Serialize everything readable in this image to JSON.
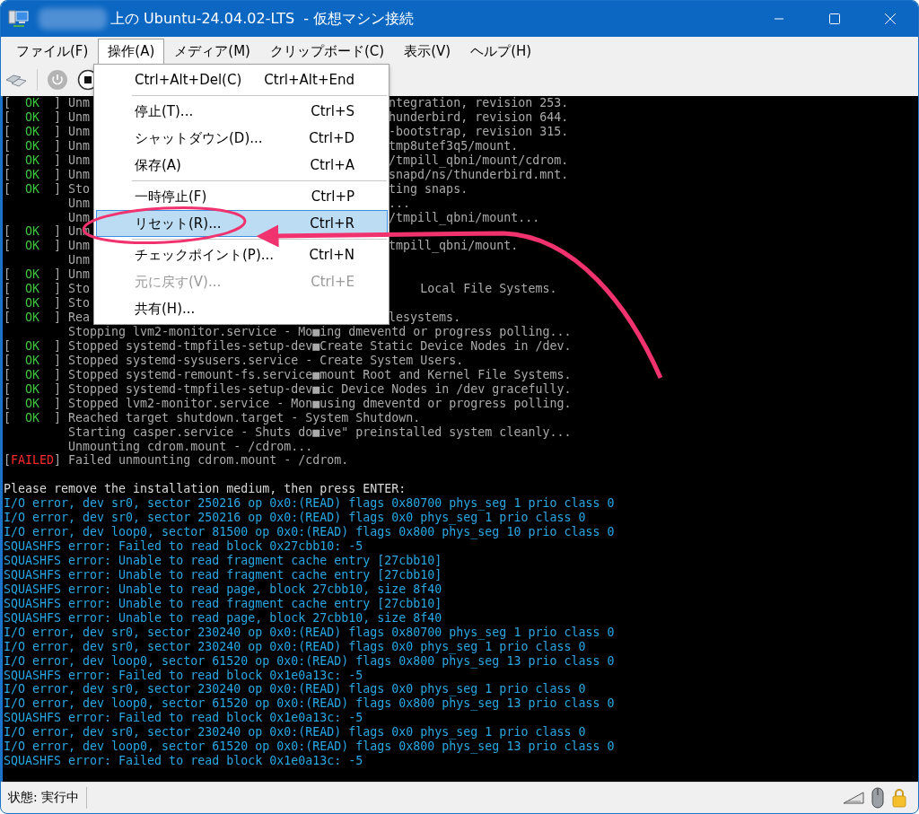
{
  "window": {
    "title": "上の Ubuntu-24.04.02-LTS  - 仮想マシン接続"
  },
  "menu_bar": [
    {
      "label": "ファイル(F)",
      "selected": false
    },
    {
      "label": "操作(A)",
      "selected": true
    },
    {
      "label": "メディア(M)",
      "selected": false
    },
    {
      "label": "クリップボード(C)",
      "selected": false
    },
    {
      "label": "表示(V)",
      "selected": false
    },
    {
      "label": "ヘルプ(H)",
      "selected": false
    }
  ],
  "dropdown": [
    {
      "kind": "item",
      "label": "Ctrl+Alt+Del(C)",
      "shortcut": "Ctrl+Alt+End",
      "selected": false,
      "disabled": false
    },
    {
      "kind": "separator"
    },
    {
      "kind": "item",
      "label": "停止(T)...",
      "shortcut": "Ctrl+S",
      "selected": false,
      "disabled": false
    },
    {
      "kind": "item",
      "label": "シャットダウン(D)...",
      "shortcut": "Ctrl+D",
      "selected": false,
      "disabled": false
    },
    {
      "kind": "item",
      "label": "保存(A)",
      "shortcut": "Ctrl+A",
      "selected": false,
      "disabled": false
    },
    {
      "kind": "separator"
    },
    {
      "kind": "item",
      "label": "一時停止(F)",
      "shortcut": "Ctrl+P",
      "selected": false,
      "disabled": false
    },
    {
      "kind": "item",
      "label": "リセット(R)...",
      "shortcut": "Ctrl+R",
      "selected": true,
      "disabled": false
    },
    {
      "kind": "separator"
    },
    {
      "kind": "item",
      "label": "チェックポイント(P)...",
      "shortcut": "Ctrl+N",
      "selected": false,
      "disabled": false
    },
    {
      "kind": "item",
      "label": "元に戻す(V)...",
      "shortcut": "Ctrl+E",
      "selected": false,
      "disabled": true
    },
    {
      "kind": "item",
      "label": "共有(H)...",
      "selected": false,
      "disabled": false
    }
  ],
  "console": {
    "lines": [
      {
        "kind": "ok",
        "open": "[",
        "status": "OK",
        "close": "]",
        "text": "Unm",
        "tail": "ntegration, revision 253."
      },
      {
        "kind": "ok",
        "open": "[",
        "status": "OK",
        "close": "]",
        "text": "Unm",
        "tail": "hunderbird, revision 644."
      },
      {
        "kind": "ok",
        "open": "[",
        "status": "OK",
        "close": "]",
        "text": "Unm",
        "tail": "-bootstrap, revision 315."
      },
      {
        "kind": "ok",
        "open": "[",
        "status": "OK",
        "close": "]",
        "text": "Unm",
        "tail": "tmp8utef3q5/mount."
      },
      {
        "kind": "ok",
        "open": "[",
        "status": "OK",
        "close": "]",
        "text": "Unm",
        "tail": "/tmpill_qbni/mount/cdrom."
      },
      {
        "kind": "ok",
        "open": "[",
        "status": "OK",
        "close": "]",
        "text": "Unm",
        "tail": "snapd/ns/thunderbird.mnt."
      },
      {
        "kind": "ok",
        "open": "[",
        "status": "OK",
        "close": "]",
        "text": "Sto",
        "tail": "ting snaps."
      },
      {
        "kind": "indent",
        "text": "Unm",
        "tail": "..."
      },
      {
        "kind": "indent",
        "text": "Unm",
        "tail": "/tmpill_qbni/mount..."
      },
      {
        "kind": "ok",
        "open": "[",
        "status": "OK",
        "close": "]",
        "text": "Unm"
      },
      {
        "kind": "ok",
        "open": "[",
        "status": "OK",
        "close": "]",
        "text": "Unm",
        "tail": "tmpill_qbni/mount."
      },
      {
        "kind": "indent",
        "text": "Unm"
      },
      {
        "kind": "ok",
        "open": "[",
        "status": "OK",
        "close": "]",
        "text": "Unm"
      },
      {
        "kind": "ok_shifted",
        "open": "[",
        "status": "OK",
        "close": "]",
        "text": "Sto",
        "tail": "Local File Systems."
      },
      {
        "kind": "ok",
        "open": "[",
        "status": "OK",
        "close": "]",
        "text": "Sto"
      },
      {
        "kind": "ok",
        "open": "[",
        "status": "OK",
        "close": "]",
        "text": "Rea",
        "tail": "lesystems."
      },
      {
        "kind": "indent",
        "text": "Stopping lvm2-monitor.service - Mo■ing dmeventd or progress polling..."
      },
      {
        "kind": "ok",
        "open": "[",
        "status": "OK",
        "close": "]",
        "text": "Stopped systemd-tmpfiles-setup-dev■Create Static Device Nodes in /dev."
      },
      {
        "kind": "ok",
        "open": "[",
        "status": "OK",
        "close": "]",
        "text": "Stopped systemd-sysusers.service - Create System Users."
      },
      {
        "kind": "ok",
        "open": "[",
        "status": "OK",
        "close": "]",
        "text": "Stopped systemd-remount-fs.service■mount Root and Kernel File Systems."
      },
      {
        "kind": "ok",
        "open": "[",
        "status": "OK",
        "close": "]",
        "text": "Stopped systemd-tmpfiles-setup-dev■ic Device Nodes in /dev gracefully."
      },
      {
        "kind": "ok",
        "open": "[",
        "status": "OK",
        "close": "]",
        "text": "Stopped lvm2-monitor.service - Mon■using dmeventd or progress polling."
      },
      {
        "kind": "ok",
        "open": "[",
        "status": "OK",
        "close": "]",
        "text": "Reached target shutdown.target - System Shutdown."
      },
      {
        "kind": "indent",
        "text": "Starting casper.service - Shuts do■ive\" preinstalled system cleanly..."
      },
      {
        "kind": "indent",
        "text": "Unmounting cdrom.mount - /cdrom..."
      },
      {
        "kind": "failed",
        "open": "[",
        "status": "FAILED",
        "close": "]",
        "text": "Failed unmounting cdrom.mount - /cdrom."
      },
      {
        "kind": "blank"
      },
      {
        "kind": "message",
        "text": "Please remove the installation medium, then press ENTER:"
      },
      {
        "kind": "kernel",
        "text": "I/O error, dev sr0, sector 250216 op 0x0:(READ) flags 0x80700 phys_seg 1 prio class 0"
      },
      {
        "kind": "kernel",
        "text": "I/O error, dev sr0, sector 250216 op 0x0:(READ) flags 0x0 phys_seg 1 prio class 0"
      },
      {
        "kind": "kernel",
        "text": "I/O error, dev loop0, sector 81500 op 0x0:(READ) flags 0x800 phys_seg 10 prio class 0"
      },
      {
        "kind": "kernel",
        "text": "SQUASHFS error: Failed to read block 0x27cbb10: -5"
      },
      {
        "kind": "kernel",
        "text": "SQUASHFS error: Unable to read fragment cache entry [27cbb10]"
      },
      {
        "kind": "kernel",
        "text": "SQUASHFS error: Unable to read fragment cache entry [27cbb10]"
      },
      {
        "kind": "kernel",
        "text": "SQUASHFS error: Unable to read page, block 27cbb10, size 8f40"
      },
      {
        "kind": "kernel",
        "text": "SQUASHFS error: Unable to read fragment cache entry [27cbb10]"
      },
      {
        "kind": "kernel",
        "text": "SQUASHFS error: Unable to read page, block 27cbb10, size 8f40"
      },
      {
        "kind": "kernel",
        "text": "I/O error, dev sr0, sector 230240 op 0x0:(READ) flags 0x80700 phys_seg 1 prio class 0"
      },
      {
        "kind": "kernel",
        "text": "I/O error, dev sr0, sector 230240 op 0x0:(READ) flags 0x0 phys_seg 1 prio class 0"
      },
      {
        "kind": "kernel",
        "text": "I/O error, dev loop0, sector 61520 op 0x0:(READ) flags 0x800 phys_seg 13 prio class 0"
      },
      {
        "kind": "kernel",
        "text": "SQUASHFS error: Failed to read block 0x1e0a13c: -5"
      },
      {
        "kind": "kernel",
        "text": "I/O error, dev sr0, sector 230240 op 0x0:(READ) flags 0x0 phys_seg 1 prio class 0"
      },
      {
        "kind": "kernel",
        "text": "I/O error, dev loop0, sector 61520 op 0x0:(READ) flags 0x800 phys_seg 13 prio class 0"
      },
      {
        "kind": "kernel",
        "text": "SQUASHFS error: Failed to read block 0x1e0a13c: -5"
      },
      {
        "kind": "kernel",
        "text": "I/O error, dev sr0, sector 230240 op 0x0:(READ) flags 0x0 phys_seg 1 prio class 0"
      },
      {
        "kind": "kernel",
        "text": "I/O error, dev loop0, sector 61520 op 0x0:(READ) flags 0x800 phys_seg 13 prio class 0"
      },
      {
        "kind": "kernel",
        "text": "SQUASHFS error: Failed to read block 0x1e0a13c: -5"
      }
    ]
  },
  "status_bar": {
    "text": "状態: 実行中"
  }
}
